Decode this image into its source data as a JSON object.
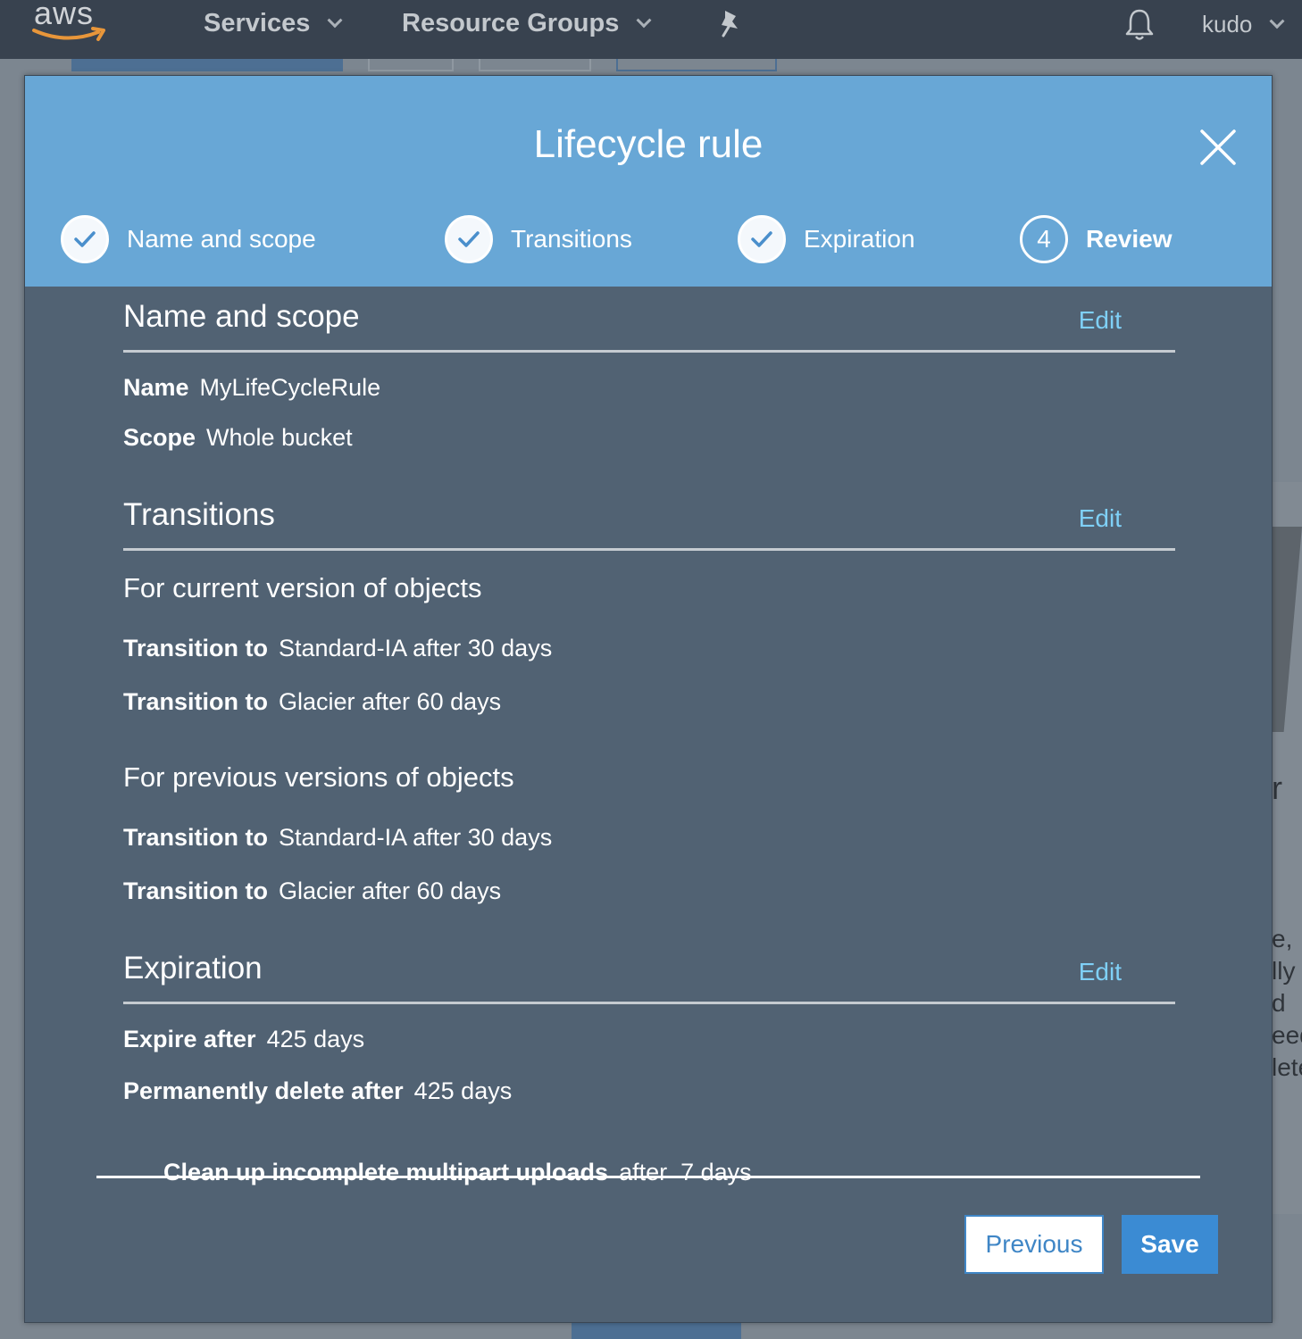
{
  "nav": {
    "logo_text": "aws",
    "services": "Services",
    "resource_groups": "Resource Groups",
    "user": "kudo"
  },
  "background": {
    "fragments": [
      "r",
      "e,",
      "lly",
      "d",
      "eed",
      "lete"
    ]
  },
  "modal": {
    "title": "Lifecycle rule",
    "steps": [
      {
        "label": "Name and scope",
        "state": "complete"
      },
      {
        "label": "Transitions",
        "state": "complete"
      },
      {
        "label": "Expiration",
        "state": "complete"
      },
      {
        "label": "Review",
        "number": "4",
        "state": "active"
      }
    ],
    "sections": {
      "name_scope": {
        "title": "Name and scope",
        "edit": "Edit",
        "name_label": "Name",
        "name_value": "MyLifeCycleRule",
        "scope_label": "Scope",
        "scope_value": "Whole bucket"
      },
      "transitions": {
        "title": "Transitions",
        "edit": "Edit",
        "current_heading": "For current version of objects",
        "current": [
          {
            "label": "Transition to",
            "value": "Standard-IA after 30 days"
          },
          {
            "label": "Transition to",
            "value": "Glacier after 60 days"
          }
        ],
        "previous_heading": "For previous versions of objects",
        "previous": [
          {
            "label": "Transition to",
            "value": "Standard-IA after 30 days"
          },
          {
            "label": "Transition to",
            "value": "Glacier after 60 days"
          }
        ]
      },
      "expiration": {
        "title": "Expiration",
        "edit": "Edit",
        "expire_label": "Expire after",
        "expire_value": "425 days",
        "delete_label": "Permanently delete after",
        "delete_value": "425 days",
        "cleanup_label": "Clean up incomplete multipart uploads",
        "cleanup_value": "after  7 days"
      }
    },
    "buttons": {
      "previous": "Previous",
      "save": "Save"
    }
  },
  "colors": {
    "nav_bg": "#38424f",
    "header_bg": "#68a7d6",
    "modal_body": "#516273",
    "edit_link": "#7fd0f7",
    "primary": "#3b8bd3"
  }
}
